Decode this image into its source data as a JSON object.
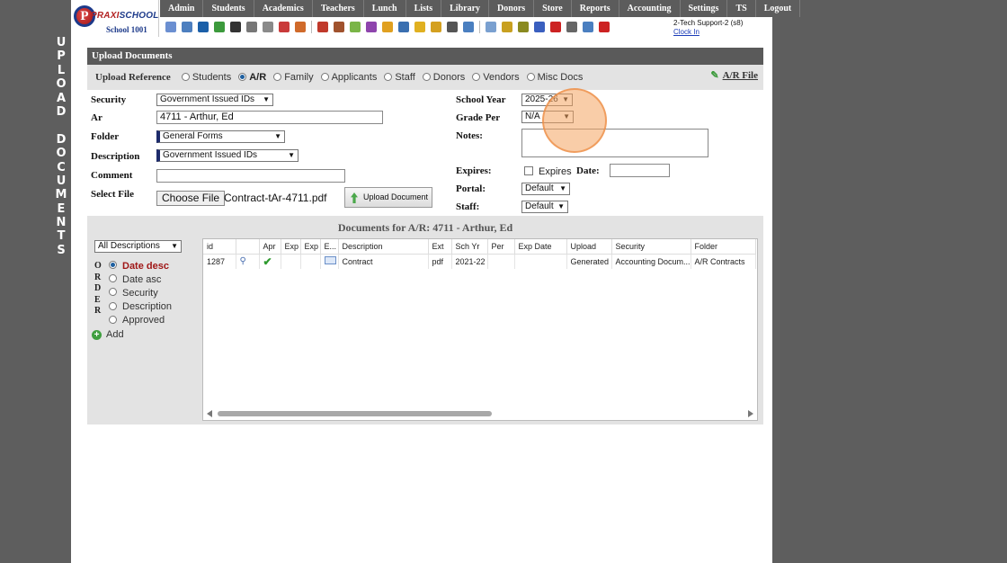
{
  "side_label": [
    "U",
    "P",
    "L",
    "O",
    "A",
    "D",
    "",
    "D",
    "O",
    "C",
    "U",
    "M",
    "E",
    "N",
    "T",
    "S"
  ],
  "logo": {
    "brand_a": "PRAXI",
    "brand_b": "SCHOOL",
    "school": "School 1001"
  },
  "menu": [
    "Admin",
    "Students",
    "Academics",
    "Teachers",
    "Lunch",
    "Lists",
    "Library",
    "Donors",
    "Store",
    "Reports",
    "Accounting",
    "Settings",
    "TS",
    "Logout"
  ],
  "toolbar_icons": [
    {
      "name": "search-icon",
      "color": "#6b8fd1"
    },
    {
      "name": "id-card-icon",
      "color": "#4d7fbf"
    },
    {
      "name": "email-at-icon",
      "color": "#1b5fa8"
    },
    {
      "name": "money-icon",
      "color": "#3c9a3c"
    },
    {
      "name": "phone-icon",
      "color": "#333333"
    },
    {
      "name": "speaker-icon",
      "color": "#777777"
    },
    {
      "name": "grid-icon",
      "color": "#8a8a8a"
    },
    {
      "name": "calendar-icon",
      "color": "#c93a3a"
    },
    {
      "name": "megaphone-icon",
      "color": "#d06a2a"
    },
    {
      "name": "sep",
      "color": ""
    },
    {
      "name": "person-icon",
      "color": "#c0392b"
    },
    {
      "name": "person-alt-icon",
      "color": "#a0522d"
    },
    {
      "name": "tag-icon",
      "color": "#7ab547"
    },
    {
      "name": "people-icon",
      "color": "#8e44ad"
    },
    {
      "name": "card-icon",
      "color": "#e0a020"
    },
    {
      "name": "book-icon",
      "color": "#3a6fb0"
    },
    {
      "name": "feather-icon",
      "color": "#e0b020"
    },
    {
      "name": "folder-icon",
      "color": "#d4a020"
    },
    {
      "name": "user-icon",
      "color": "#555555"
    },
    {
      "name": "clock-icon",
      "color": "#4a7fc0"
    },
    {
      "name": "sep",
      "color": ""
    },
    {
      "name": "list-icon",
      "color": "#7aa0d0"
    },
    {
      "name": "barcode-icon",
      "color": "#c8a020"
    },
    {
      "name": "scanner-icon",
      "color": "#8a8a20"
    },
    {
      "name": "ar-icon",
      "color": "#3a5fbf"
    },
    {
      "name": "pdf-icon",
      "color": "#cc2222"
    },
    {
      "name": "printer-icon",
      "color": "#666666"
    },
    {
      "name": "help-icon",
      "color": "#4a7fc0"
    },
    {
      "name": "power-icon",
      "color": "#cc2222"
    }
  ],
  "user": {
    "name": "2-Tech Support-2 (s8)",
    "clock": "Clock In"
  },
  "panel_title": "Upload Documents",
  "reference": {
    "label": "Upload Reference",
    "options": [
      "Students",
      "A/R",
      "Family",
      "Applicants",
      "Staff",
      "Donors",
      "Vendors",
      "Misc Docs"
    ],
    "selected": "A/R",
    "ar_file": "A/R File"
  },
  "form": {
    "security_label": "Security",
    "security_value": "Government Issued IDs",
    "ar_label": "Ar",
    "ar_value": "4711 - Arthur, Ed",
    "folder_label": "Folder",
    "folder_value": "General Forms",
    "description_label": "Description",
    "description_value": "Government Issued IDs",
    "comment_label": "Comment",
    "comment_value": "",
    "file_label": "Select File",
    "choose_btn": "Choose File",
    "file_name": "Contract-tAr-4711.pdf",
    "upload_btn": "Upload Document",
    "school_year_label": "School Year",
    "school_year_value": "2025-26",
    "grade_per_label": "Grade Per",
    "grade_per_value": "N/A",
    "notes_label": "Notes:",
    "expires_label": "Expires:",
    "expires_chk": "Expires",
    "date_label": "Date:",
    "portal_label": "Portal:",
    "portal_value": "Default",
    "staff_label": "Staff:",
    "staff_value": "Default"
  },
  "documents": {
    "title": "Documents for A/R: 4711 - Arthur, Ed",
    "filter": "All Descriptions",
    "order_word": [
      "O",
      "R",
      "D",
      "E",
      "R"
    ],
    "order_options": [
      "Date desc",
      "Date asc",
      "Security",
      "Description",
      "Approved"
    ],
    "order_selected": "Date desc",
    "add": "Add",
    "columns": [
      "id",
      "",
      "Apr",
      "Exp",
      "Exp",
      "E...",
      "Description",
      "Ext",
      "Sch Yr",
      "Per",
      "Exp Date",
      "Upload",
      "Security",
      "Folder"
    ],
    "rows": [
      [
        "1287",
        "",
        "",
        "",
        "",
        "",
        "Contract",
        "pdf",
        "2021-22",
        "",
        "",
        "Generated",
        "Accounting Docum...",
        "A/R Contracts"
      ]
    ]
  }
}
